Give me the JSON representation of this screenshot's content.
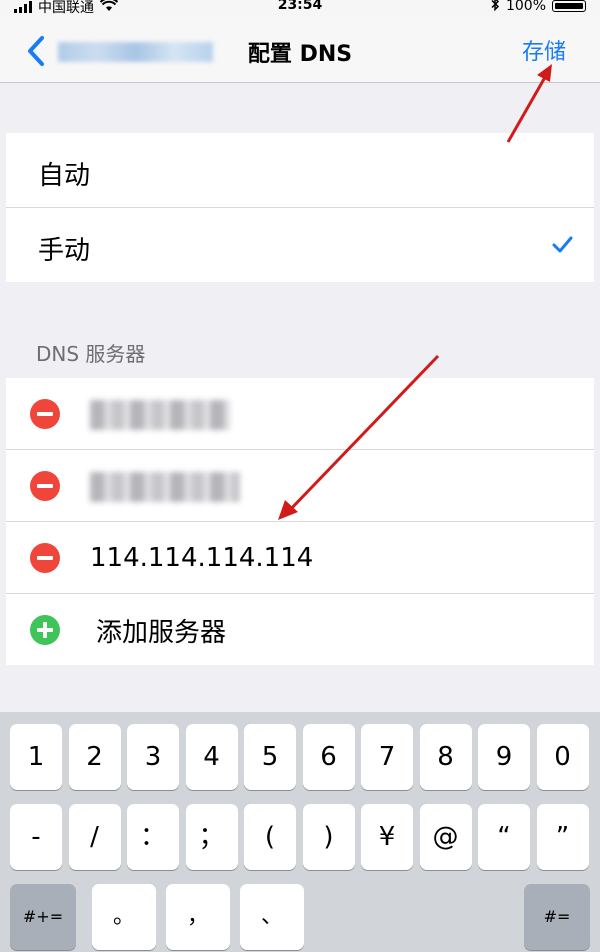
{
  "status_bar": {
    "carrier": "中国联通",
    "time": "23:54",
    "battery": "100%"
  },
  "nav": {
    "title": "配置 DNS",
    "save": "存储"
  },
  "mode_options": [
    {
      "label": "自动",
      "selected": false
    },
    {
      "label": "手动",
      "selected": true
    }
  ],
  "dns_section": {
    "header": "DNS 服务器",
    "new_server_value": "114.114.114.114",
    "add_label": "添加服务器"
  },
  "keyboard": {
    "row1": [
      "1",
      "2",
      "3",
      "4",
      "5",
      "6",
      "7",
      "8",
      "9",
      "0"
    ],
    "row2": [
      "-",
      "/",
      "：",
      "；",
      "(",
      ")",
      "¥",
      "@",
      "“",
      "”"
    ],
    "row3_left": "#+=",
    "row3_mid": [
      "。",
      "，",
      "、"
    ],
    "row3_right": "#="
  },
  "colors": {
    "accent": "#1a7cf4",
    "delete": "#f0453b",
    "add": "#3fc45a",
    "annotation": "#d11a1a"
  }
}
